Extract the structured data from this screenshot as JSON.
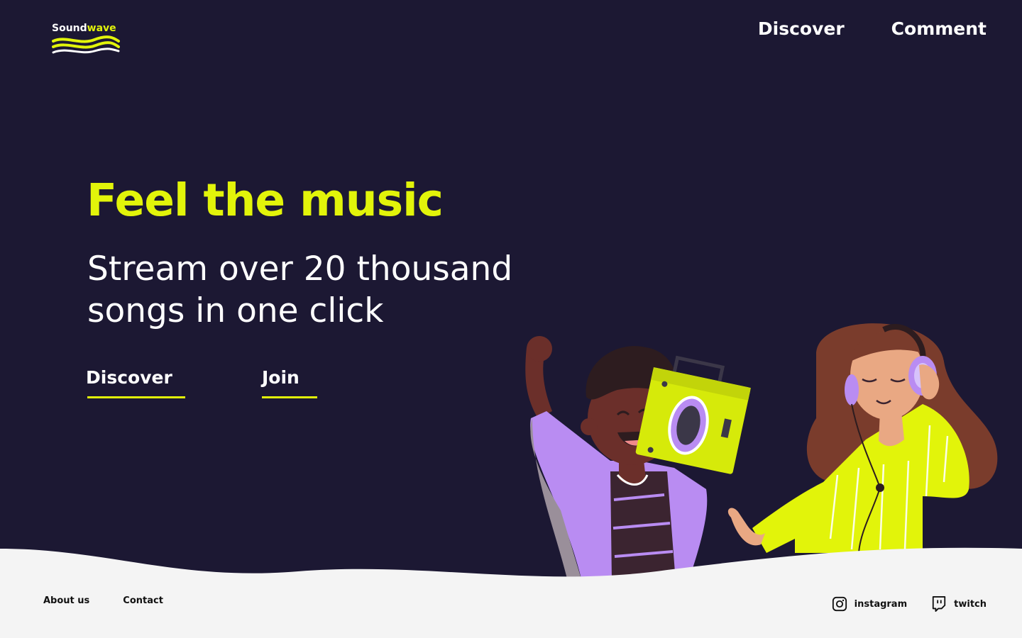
{
  "brand": {
    "name_part1": "Sound",
    "name_part2": "wave",
    "accent_color": "#e2f40a",
    "background_color": "#1c1833"
  },
  "nav": {
    "items": [
      {
        "label": "Discover"
      },
      {
        "label": "Comment"
      }
    ]
  },
  "hero": {
    "title": "Feel the music",
    "subtitle_line1": "Stream over 20 thousand",
    "subtitle_line2": "songs in one click",
    "cta_primary": "Discover",
    "cta_secondary": "Join"
  },
  "footer": {
    "links": [
      {
        "label": "About us"
      },
      {
        "label": "Contact"
      }
    ],
    "social": [
      {
        "label": "instagram",
        "icon": "instagram-icon"
      },
      {
        "label": "twitch",
        "icon": "twitch-icon"
      }
    ]
  }
}
